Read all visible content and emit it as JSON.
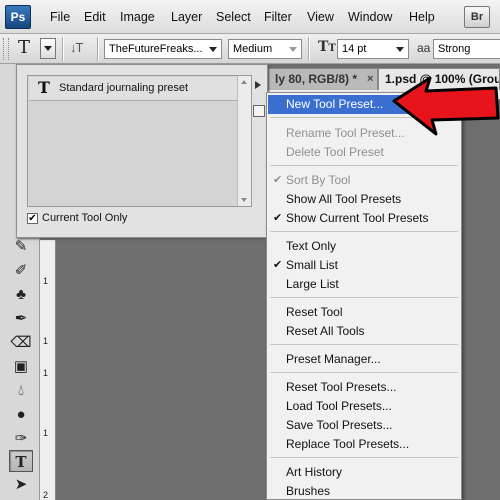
{
  "menubar": {
    "logo": "Ps",
    "items": [
      "File",
      "Edit",
      "Image",
      "Layer",
      "Select",
      "Filter",
      "View",
      "Window",
      "Help"
    ],
    "bridge_logo": "Br"
  },
  "options": {
    "font_family": "TheFutureFreaks...",
    "font_style": "Medium",
    "font_size": "14 pt",
    "antialias_icon": "aa",
    "antialias": "Strong"
  },
  "documents": {
    "tab1": "ly 80, RGB/8) *",
    "tab1_close": "×",
    "tab2": "1.psd @ 100% (Group -"
  },
  "ruler": {
    "labels": [
      "1",
      "1",
      "1",
      "1",
      "2"
    ]
  },
  "preset_panel": {
    "preset_name": "Standard journaling preset",
    "current_tool_only_label": "Current Tool Only",
    "current_tool_only_checked": true
  },
  "flyout": {
    "new_tool_preset": "New Tool Preset...",
    "rename_tool_preset": "Rename Tool Preset...",
    "delete_tool_preset": "Delete Tool Preset",
    "sort_by_tool": "Sort By Tool",
    "show_all_tool_presets": "Show All Tool Presets",
    "show_current_tool_presets": "Show Current Tool Presets",
    "text_only": "Text Only",
    "small_list": "Small List",
    "large_list": "Large List",
    "reset_tool": "Reset Tool",
    "reset_all_tools": "Reset All Tools",
    "preset_manager": "Preset Manager...",
    "reset_tool_presets": "Reset Tool Presets...",
    "load_tool_presets": "Load Tool Presets...",
    "save_tool_presets": "Save Tool Presets...",
    "replace_tool_presets": "Replace Tool Presets...",
    "art_history": "Art History",
    "brushes": "Brushes",
    "check_glyph": "✔"
  },
  "colors": {
    "selection": "#3a6fd0",
    "annotation_arrow": "#e8141b"
  }
}
